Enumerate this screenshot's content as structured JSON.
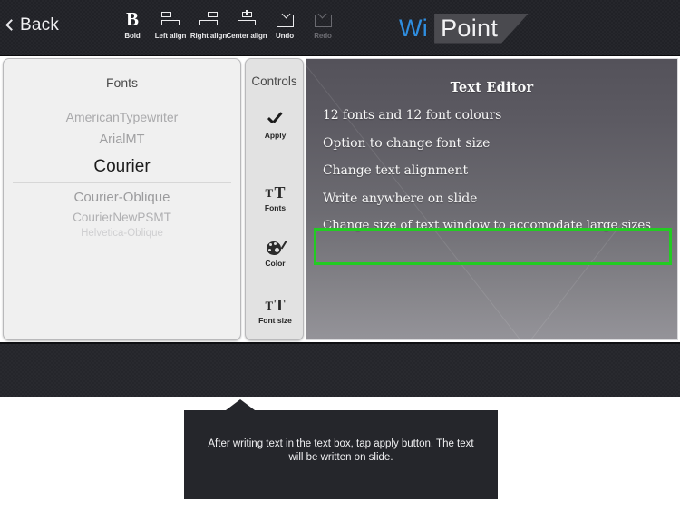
{
  "topbar": {
    "back_label": "Back",
    "back_icon": "chevron-left-icon",
    "tools": [
      {
        "label": "Bold",
        "icon": "bold-icon",
        "disabled": false
      },
      {
        "label": "Left align",
        "icon": "left-align-icon",
        "disabled": false
      },
      {
        "label": "Right align",
        "icon": "right-align-icon",
        "disabled": false
      },
      {
        "label": "Center align",
        "icon": "center-align-icon",
        "disabled": false
      },
      {
        "label": "Undo",
        "icon": "undo-icon",
        "disabled": false
      },
      {
        "label": "Redo",
        "icon": "redo-icon",
        "disabled": true
      }
    ],
    "logo": {
      "part1": "Wi",
      "part2": "Point",
      "part1_color": "#2f8ee0",
      "shape_color": "#4a4a4f"
    },
    "background_color": "#212227"
  },
  "fonts_panel": {
    "title": "Fonts",
    "items": [
      "AmericanTypewriter",
      "ArialMT",
      "Courier",
      "Courier-Oblique",
      "CourierNewPSMT",
      "Helvetica-Oblique"
    ],
    "selected": "Courier",
    "selected_index": 2
  },
  "controls_panel": {
    "title": "Controls",
    "items": [
      {
        "label": "Apply",
        "icon": "check-icon"
      },
      {
        "label": "Fonts",
        "icon": "font-tt-icon"
      },
      {
        "label": "Color",
        "icon": "palette-icon"
      },
      {
        "label": "Font size",
        "icon": "font-size-icon"
      }
    ]
  },
  "slide": {
    "title": "Text Editor",
    "lines": [
      "12 fonts and 12 font colours",
      "Option to change font size",
      "Change text alignment",
      "Write anywhere on slide",
      "Change size of text window to accomodate large sizes"
    ],
    "textbox": {
      "value": "",
      "placeholder": "",
      "border_color": "#22cc22"
    }
  },
  "tooltip": {
    "text": "After writing text in the text box, tap apply button. The text will be written on slide.",
    "background_color": "#25262b"
  }
}
